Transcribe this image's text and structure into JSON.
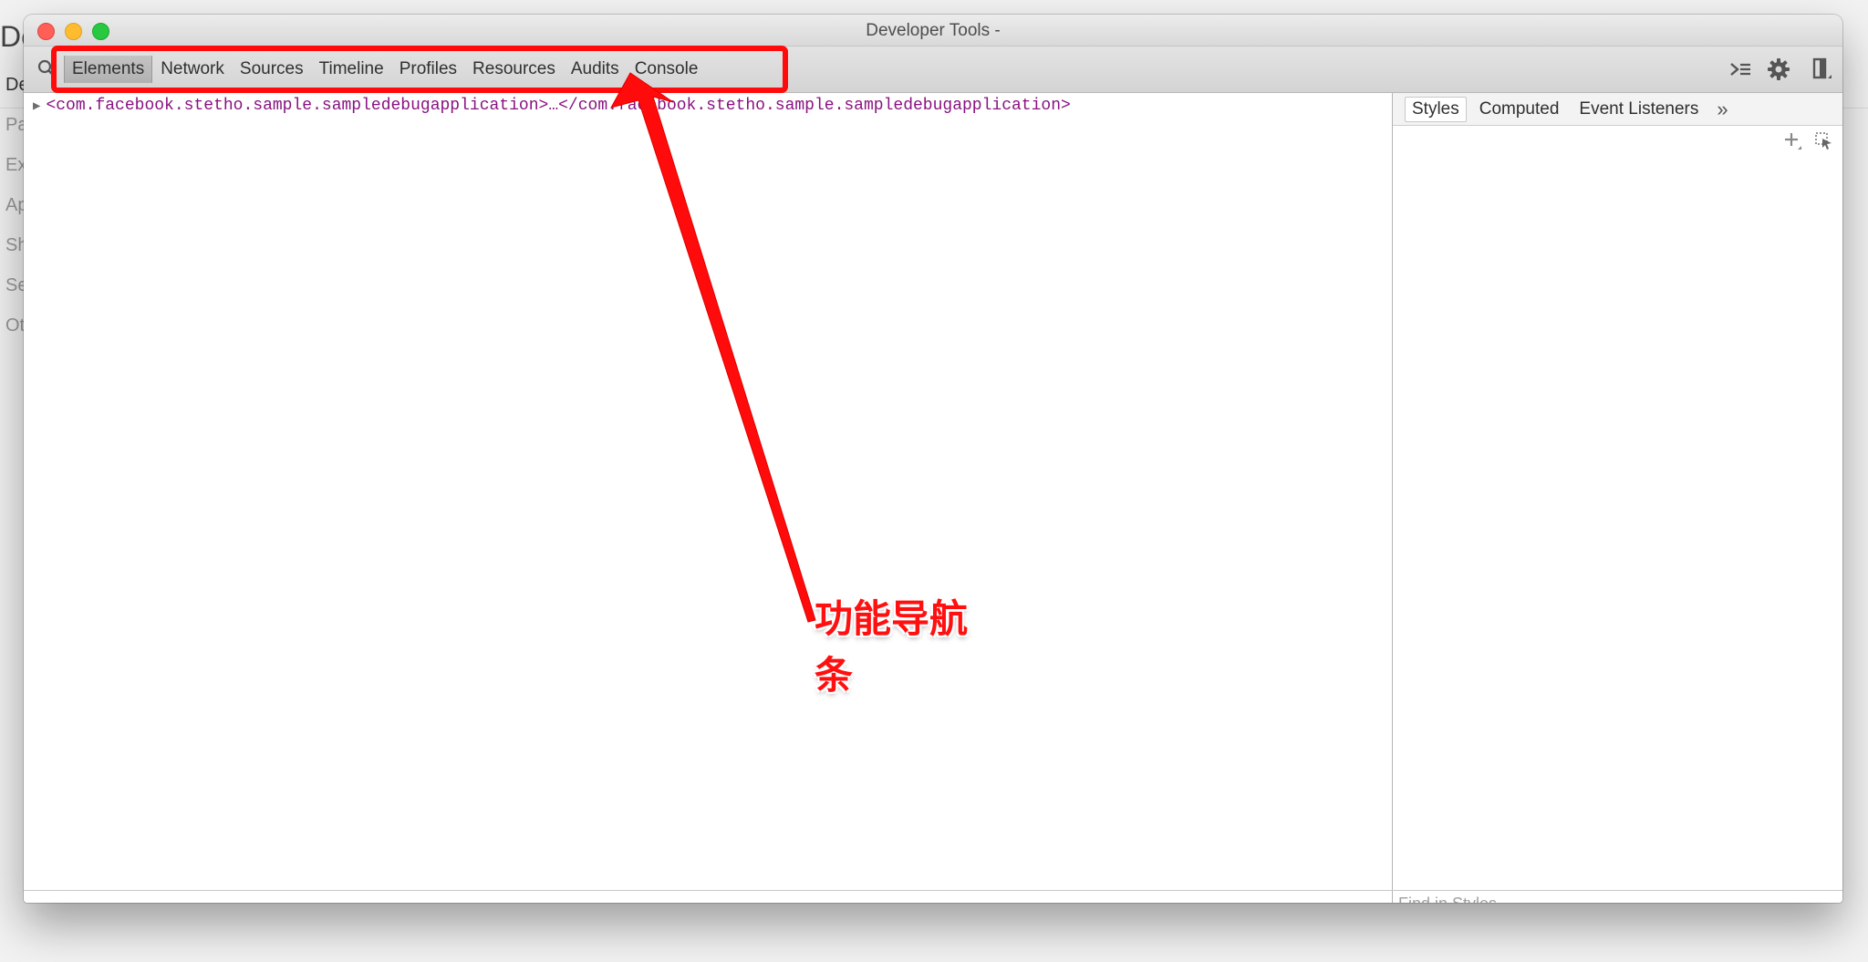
{
  "background_page": {
    "title_fragment": "De",
    "items": [
      "De",
      "Pa",
      "Ex",
      "Ap",
      "Sh",
      "Se",
      "Ot"
    ]
  },
  "window": {
    "title": "Developer Tools -"
  },
  "toolbar": {
    "tabs": [
      "Elements",
      "Network",
      "Sources",
      "Timeline",
      "Profiles",
      "Resources",
      "Audits",
      "Console"
    ],
    "active_tab": "Elements",
    "icons": [
      "search-icon",
      "console-drawer-icon",
      "gear-icon",
      "dock-icon"
    ]
  },
  "elements": {
    "dom_line": "<com.facebook.stetho.sample.sampledebugapplication>…</com.facebook.stetho.sample.sampledebugapplication>"
  },
  "sidebar": {
    "tabs": [
      "Styles",
      "Computed",
      "Event Listeners"
    ],
    "active_tab": "Styles",
    "more": "»",
    "tools": [
      "new-style-rule-icon",
      "element-state-icon"
    ]
  },
  "footer": {
    "find_placeholder": "Find in Styles"
  },
  "annotation": {
    "label": "功能导航条",
    "color": "#ff0b0b"
  },
  "colors": {
    "dom_tag": "#881280",
    "close": "#ff5f57",
    "minimize": "#febc2e",
    "maximize": "#28c840"
  }
}
